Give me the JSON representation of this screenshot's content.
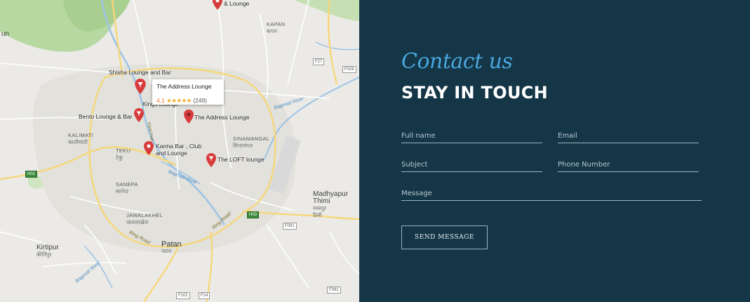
{
  "map": {
    "areas": [
      {
        "name": "KAPAN",
        "sub": "कपन"
      },
      {
        "name": "KALIMATI",
        "sub": "कालीमाटी"
      },
      {
        "name": "TEKU",
        "sub": "टेकु"
      },
      {
        "name": "SINAMANGAL",
        "sub": "सिनामंगल"
      },
      {
        "name": "SANEPA",
        "sub": "सानेपा"
      },
      {
        "name": "JAWALAKHEL",
        "sub": "जावलाखेल"
      }
    ],
    "cities": [
      {
        "name": "Madhyapur Thimi",
        "line1": "Madhyapur",
        "line2": "Thimi",
        "sub": "मध्यपुर",
        "sub2": "ठिमी"
      },
      {
        "name": "Patan",
        "sub": "पाटन"
      },
      {
        "name": "Kirtipur",
        "sub": "कीर्तिपुर"
      }
    ],
    "partial_label": "un",
    "pois": [
      {
        "name": "& Lounge"
      },
      {
        "name": "Shisha Lounge and Bar"
      },
      {
        "name": "Kings Lounge"
      },
      {
        "name": "Bento Lounge & Bar"
      },
      {
        "name": "The Address Lounge"
      },
      {
        "name": "Karma Bar , Club and Lounge",
        "line1": "Karma Bar , Club",
        "line2": "and Lounge"
      },
      {
        "name": "The LOFT lounge"
      }
    ],
    "roads": [
      "Ring Road",
      "Ring Road",
      "Bagmati River",
      "Bagmati River",
      "Bagmati River",
      "Kanti Path"
    ],
    "shields": [
      "F27",
      "F026",
      "H02",
      "H03",
      "F091",
      "F102",
      "F24",
      "F091"
    ],
    "tooltip": {
      "title": "The Address Lounge",
      "rating": "4.1",
      "stars": "★★★★★",
      "count": "(249)"
    }
  },
  "contact": {
    "kicker": "Contact us",
    "heading": "STAY IN TOUCH",
    "fields": {
      "full_name": "Full name",
      "email": "Email",
      "subject": "Subject",
      "phone": "Phone Number",
      "message": "Message"
    },
    "submit_label": "SEND MESSAGE"
  },
  "colors": {
    "panel_bg": "#143647",
    "accent": "#4aa6dc",
    "map_pin": "#d83b3b"
  }
}
